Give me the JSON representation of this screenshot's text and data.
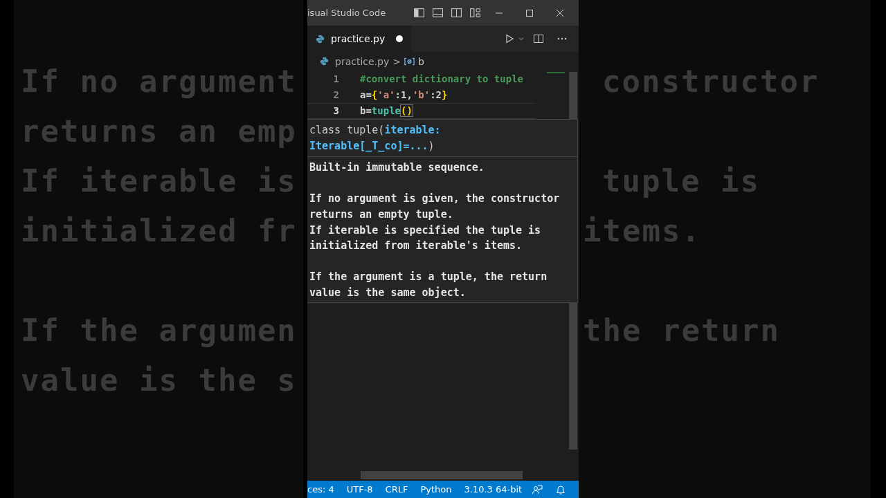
{
  "backdrop": {
    "rows": [
      {
        "kind": "text",
        "left": "If no argument",
        "right": "constructor",
        "right_indented": true
      },
      {
        "kind": "text",
        "left": "returns an emp"
      },
      {
        "kind": "text",
        "left": "If iterable is",
        "right": "tuple is",
        "right_indented": true
      },
      {
        "kind": "text",
        "left": "initialized fr",
        "right": "items.",
        "right_indented": false
      },
      {
        "kind": "blank"
      },
      {
        "kind": "text",
        "left": "If the argumen",
        "right": "the return",
        "right_indented": false
      },
      {
        "kind": "text",
        "left": "value is the s"
      }
    ]
  },
  "window": {
    "title": "isual Studio Code"
  },
  "tabs": [
    {
      "label": "practice.py",
      "selected": true,
      "modified": true
    }
  ],
  "breadcrumb": {
    "file": "practice.py",
    "separator": ">",
    "symbol": "b"
  },
  "editor": {
    "lines": [
      {
        "number": "1",
        "active": false,
        "tokens": [
          {
            "kind": "comment",
            "text": "#convert dictionary to tuple"
          }
        ]
      },
      {
        "number": "2",
        "active": false,
        "tokens": [
          {
            "kind": "plain",
            "text": "a="
          },
          {
            "kind": "bracket",
            "text": "{"
          },
          {
            "kind": "string",
            "text": "'a'"
          },
          {
            "kind": "plain",
            "text": ":1,"
          },
          {
            "kind": "string",
            "text": "'b'"
          },
          {
            "kind": "plain",
            "text": ":2"
          },
          {
            "kind": "bracket",
            "text": "}"
          }
        ]
      },
      {
        "number": "3",
        "active": true,
        "tokens": [
          {
            "kind": "plain",
            "text": "b="
          },
          {
            "kind": "builtin",
            "text": "tuple"
          },
          {
            "kind": "matched",
            "text": "()"
          }
        ]
      }
    ]
  },
  "hover": {
    "signature": [
      "class tuple(**iterable:**",
      "**Iterable[_T_co]=...**)"
    ],
    "paragraphs": [
      [
        "Built-in immutable sequence."
      ],
      [
        "If no argument is given, the constructor returns an empty tuple.",
        "If iterable is specified the tuple is initialized from iterable's items."
      ],
      [
        "If the argument is a tuple, the return value is the same object."
      ]
    ]
  },
  "status_bar": {
    "items": [
      "ces: 4",
      "UTF-8",
      "CRLF",
      "Python",
      "3.10.3 64-bit"
    ]
  }
}
